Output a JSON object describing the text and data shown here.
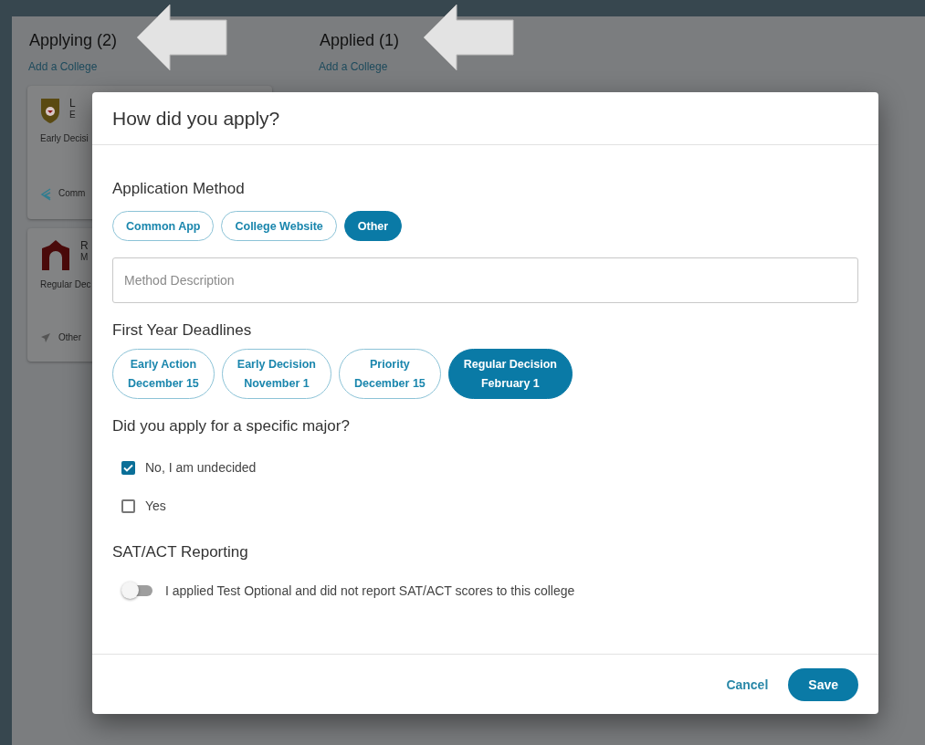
{
  "board": {
    "columns": [
      {
        "title": "Applying (2)",
        "link": "Add a College",
        "cards": [
          {
            "logo": {
              "kind": "crest"
            },
            "name": "L",
            "location": "E",
            "deadline": "Early Decisi",
            "method": {
              "kind": "swoosh",
              "label": "Comm"
            }
          },
          {
            "logo": {
              "kind": "arch"
            },
            "name": "R",
            "location": "M",
            "deadline": "Regular Dec",
            "method": {
              "kind": "plane",
              "label": "Other"
            }
          }
        ]
      },
      {
        "title": "Applied (1)",
        "link": "Add a College"
      }
    ]
  },
  "dialog": {
    "title": "How did you apply?",
    "method": {
      "heading": "Application Method",
      "options": [
        {
          "label": "Common App",
          "selected": false
        },
        {
          "label": "College Website",
          "selected": false
        },
        {
          "label": "Other",
          "selected": true
        }
      ],
      "placeholder": "Method Description"
    },
    "deadlines": {
      "heading": "First Year Deadlines",
      "options": [
        {
          "label": "Early Action",
          "date": "December 15",
          "selected": false
        },
        {
          "label": "Early Decision",
          "date": "November 1",
          "selected": false
        },
        {
          "label": "Priority",
          "date": "December 15",
          "selected": false
        },
        {
          "label": "Regular Decision",
          "date": "February 1",
          "selected": true
        }
      ]
    },
    "major": {
      "heading": "Did you apply for a specific major?",
      "options": [
        {
          "label": "No, I am undecided",
          "checked": true
        },
        {
          "label": "Yes",
          "checked": false
        }
      ]
    },
    "reporting": {
      "heading": "SAT/ACT Reporting",
      "toggle": {
        "label": "I applied Test Optional and did not report SAT/ACT scores to this college",
        "on": false
      }
    },
    "cancel": "Cancel",
    "save": "Save"
  }
}
